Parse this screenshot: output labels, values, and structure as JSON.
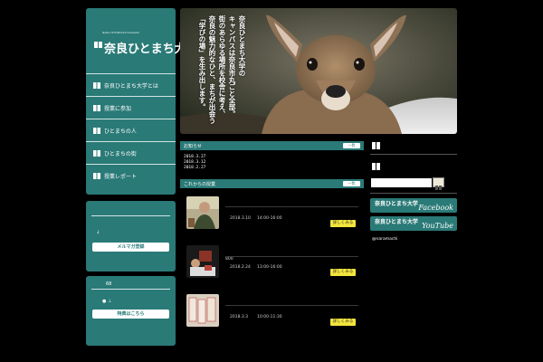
{
  "sidebar": {
    "logo_small": "NARA HITOMACHI DAIGAKU",
    "logo_text": "奈良ひとまち大学",
    "nav_items": [
      {
        "label": "奈良ひとまち大学とは"
      },
      {
        "label": "授業に参加"
      },
      {
        "label": "ひとまちの人"
      },
      {
        "label": "ひとまちの街"
      },
      {
        "label": "授業レポート"
      }
    ],
    "mail": {
      "arrow": "↓",
      "button": "メルマガ登録"
    },
    "special": {
      "count": "68",
      "marks": "●  ⊥",
      "button": "特典はこちら"
    }
  },
  "hero": {
    "tagline_lines": [
      "奈良ひとまち大学の",
      "キャンパスは奈良市丸ごと全部。",
      "街のあらゆる場所を校舎に考え、",
      "奈良の魅力的なひと、まちが出会う",
      "「学びの場」を生み出します。"
    ]
  },
  "news": {
    "title": "お知らせ",
    "button": "一覧",
    "dates": [
      "2018.3.27",
      "2018.3.12",
      "2018.2.27"
    ]
  },
  "events": {
    "title": "これからの授業",
    "button": "一覧",
    "items": [
      {
        "date": "2018.3.10",
        "time": "14:00-16:00",
        "meta": "",
        "button": "詳しくみる"
      },
      {
        "date": "2018.2.24",
        "time": "13:00-16:00",
        "meta": "800",
        "button": "詳しくみる"
      },
      {
        "date": "2018.3.3",
        "time": "10:00-11:30",
        "meta": "",
        "button": "詳しくみる"
      }
    ]
  },
  "right": {
    "search_placeholder": "",
    "facebook": {
      "brand": "奈良ひとまち大学",
      "name": "Facebook"
    },
    "youtube": {
      "brand": "奈良ひとまち大学",
      "name": "YouTube"
    },
    "handle": "@naramachi"
  },
  "colors": {
    "accent": "#2a7a77",
    "button_yellow": "#f2e53c",
    "background": "#000000"
  }
}
